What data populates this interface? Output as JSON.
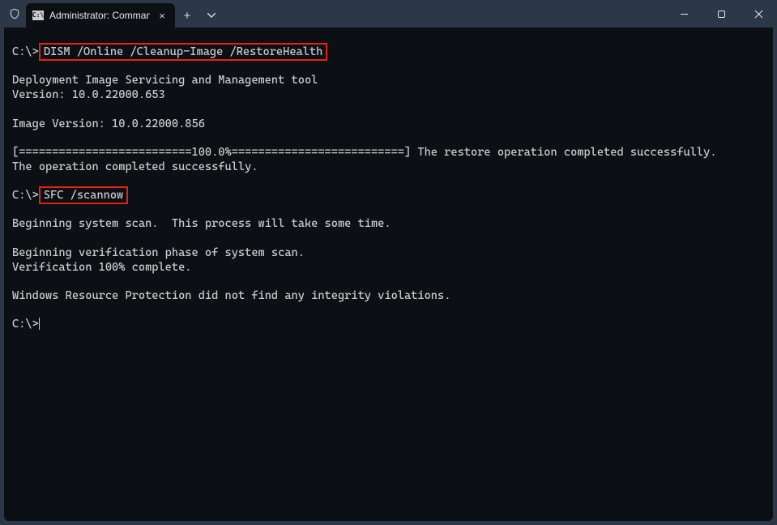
{
  "titlebar": {
    "tab_title": "Administrator: Command Pro",
    "cmd_icon_text": "C:\\"
  },
  "terminal": {
    "prompt": "C:\\>",
    "cmd1_highlight": "DISM /Online /Cleanup-Image /RestoreHealth",
    "line_blank": "",
    "line_dism1": "Deployment Image Servicing and Management tool",
    "line_dism2": "Version: 10.0.22000.653",
    "line_imgver": "Image Version: 10.0.22000.856",
    "line_progress": "[==========================100.0%==========================] The restore operation completed successfully.",
    "line_opdone": "The operation completed successfully.",
    "cmd2_highlight": "SFC /scannow",
    "line_sfc1": "Beginning system scan.  This process will take some time.",
    "line_sfc2": "Beginning verification phase of system scan.",
    "line_sfc3": "Verification 100% complete.",
    "line_sfc4": "Windows Resource Protection did not find any integrity violations."
  }
}
